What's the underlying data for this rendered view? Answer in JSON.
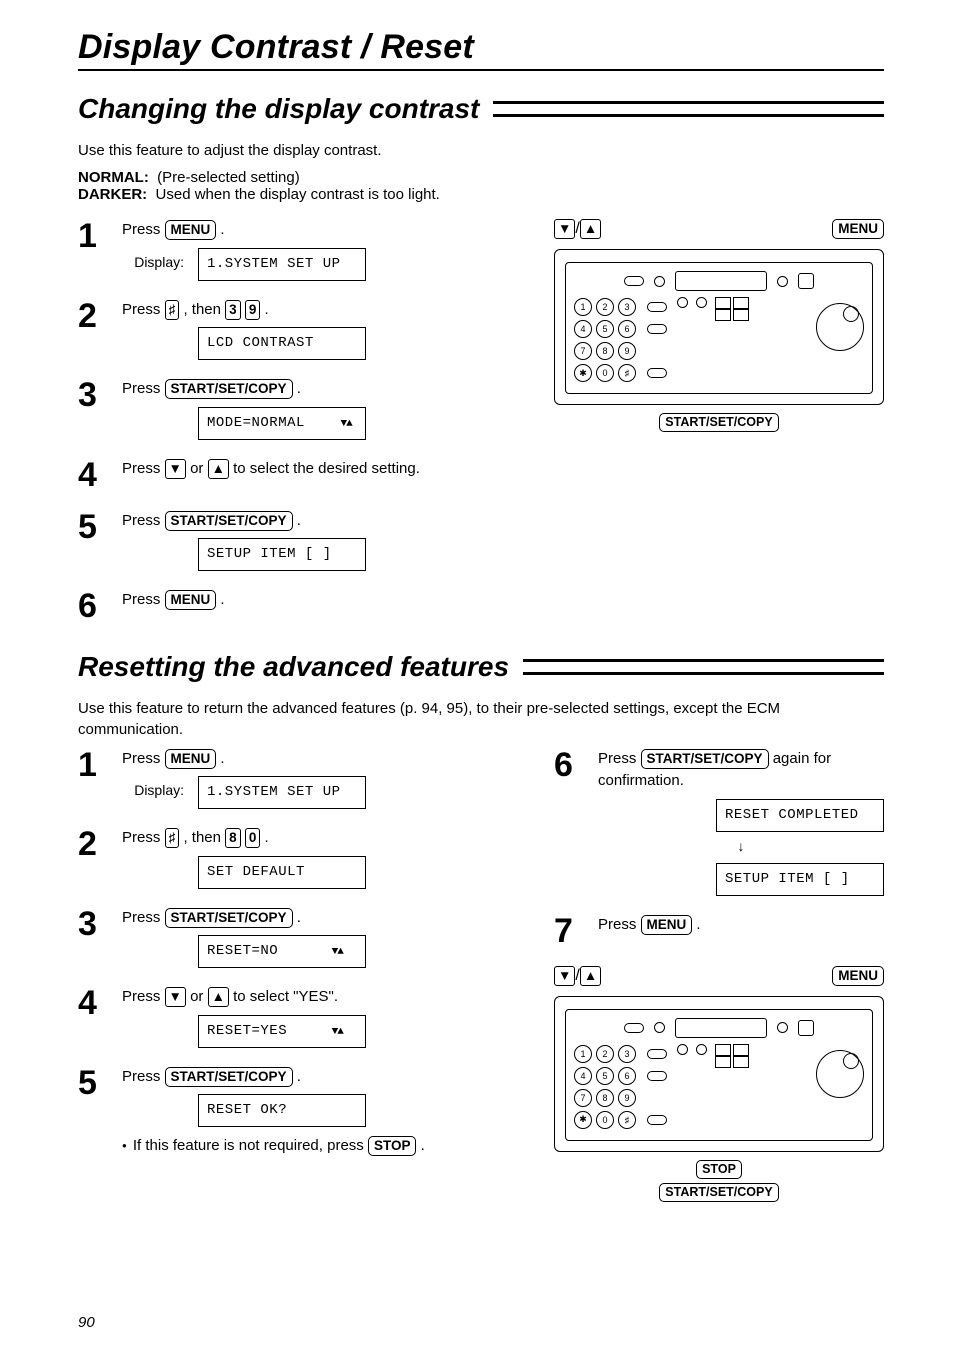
{
  "page_title": "Display Contrast / Reset",
  "page_number": "90",
  "buttons": {
    "menu": "MENU",
    "start": "START/SET/COPY",
    "stop": "STOP",
    "hash": "♯",
    "down": "▼",
    "up": "▲",
    "three": "3",
    "nine": "9",
    "eight": "8",
    "zero": "0"
  },
  "labels": {
    "press": "Press ",
    "display": "Display:",
    "then": ", then ",
    "or": " or ",
    "select_desired": " to select the desired setting.",
    "select_yes": " to select \"YES\".",
    "again_confirm": " again for confirmation.",
    "not_required": "If this feature is not required, press ",
    "arrow_pair": "▼▲",
    "arrow_sep": "/"
  },
  "section1": {
    "heading": "Changing the display contrast",
    "intro": "Use this feature to adjust the display contrast.",
    "normal_label": "NORMAL:",
    "normal_text": "(Pre-selected setting)",
    "darker_label": "DARKER:",
    "darker_text": "Used when the display contrast is too light.",
    "disp1": "1.SYSTEM SET UP",
    "disp2": "LCD CONTRAST",
    "disp3": "MODE=NORMAL",
    "disp5": "SETUP ITEM [   ]"
  },
  "section2": {
    "heading": "Resetting the advanced features",
    "intro": "Use this feature to return the advanced features (p. 94, 95), to their pre-selected settings, except the ECM communication.",
    "disp1": "1.SYSTEM SET UP",
    "disp2": "SET DEFAULT",
    "disp3": "RESET=NO",
    "disp4": "RESET=YES",
    "disp5": "RESET OK?",
    "disp6a": "RESET COMPLETED",
    "disp6b": "SETUP ITEM [   ]"
  },
  "steps": {
    "1": "1",
    "2": "2",
    "3": "3",
    "4": "4",
    "5": "5",
    "6": "6",
    "7": "7"
  },
  "keypad": {
    "r1": [
      "1",
      "2",
      "3"
    ],
    "r2": [
      "4",
      "5",
      "6"
    ],
    "r3": [
      "7",
      "8",
      "9"
    ],
    "r4": [
      "✱",
      "0",
      "♯"
    ]
  }
}
